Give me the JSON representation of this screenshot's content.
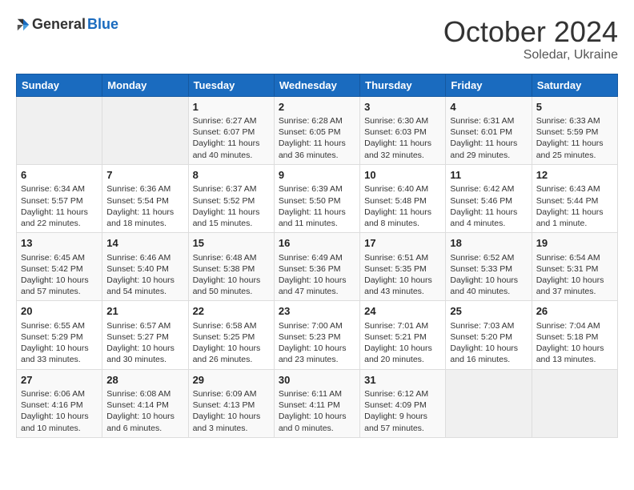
{
  "logo": {
    "general": "General",
    "blue": "Blue"
  },
  "header": {
    "month": "October 2024",
    "location": "Soledar, Ukraine"
  },
  "weekdays": [
    "Sunday",
    "Monday",
    "Tuesday",
    "Wednesday",
    "Thursday",
    "Friday",
    "Saturday"
  ],
  "weeks": [
    [
      {
        "day": "",
        "sunrise": "",
        "sunset": "",
        "daylight": ""
      },
      {
        "day": "",
        "sunrise": "",
        "sunset": "",
        "daylight": ""
      },
      {
        "day": "1",
        "sunrise": "Sunrise: 6:27 AM",
        "sunset": "Sunset: 6:07 PM",
        "daylight": "Daylight: 11 hours and 40 minutes."
      },
      {
        "day": "2",
        "sunrise": "Sunrise: 6:28 AM",
        "sunset": "Sunset: 6:05 PM",
        "daylight": "Daylight: 11 hours and 36 minutes."
      },
      {
        "day": "3",
        "sunrise": "Sunrise: 6:30 AM",
        "sunset": "Sunset: 6:03 PM",
        "daylight": "Daylight: 11 hours and 32 minutes."
      },
      {
        "day": "4",
        "sunrise": "Sunrise: 6:31 AM",
        "sunset": "Sunset: 6:01 PM",
        "daylight": "Daylight: 11 hours and 29 minutes."
      },
      {
        "day": "5",
        "sunrise": "Sunrise: 6:33 AM",
        "sunset": "Sunset: 5:59 PM",
        "daylight": "Daylight: 11 hours and 25 minutes."
      }
    ],
    [
      {
        "day": "6",
        "sunrise": "Sunrise: 6:34 AM",
        "sunset": "Sunset: 5:57 PM",
        "daylight": "Daylight: 11 hours and 22 minutes."
      },
      {
        "day": "7",
        "sunrise": "Sunrise: 6:36 AM",
        "sunset": "Sunset: 5:54 PM",
        "daylight": "Daylight: 11 hours and 18 minutes."
      },
      {
        "day": "8",
        "sunrise": "Sunrise: 6:37 AM",
        "sunset": "Sunset: 5:52 PM",
        "daylight": "Daylight: 11 hours and 15 minutes."
      },
      {
        "day": "9",
        "sunrise": "Sunrise: 6:39 AM",
        "sunset": "Sunset: 5:50 PM",
        "daylight": "Daylight: 11 hours and 11 minutes."
      },
      {
        "day": "10",
        "sunrise": "Sunrise: 6:40 AM",
        "sunset": "Sunset: 5:48 PM",
        "daylight": "Daylight: 11 hours and 8 minutes."
      },
      {
        "day": "11",
        "sunrise": "Sunrise: 6:42 AM",
        "sunset": "Sunset: 5:46 PM",
        "daylight": "Daylight: 11 hours and 4 minutes."
      },
      {
        "day": "12",
        "sunrise": "Sunrise: 6:43 AM",
        "sunset": "Sunset: 5:44 PM",
        "daylight": "Daylight: 11 hours and 1 minute."
      }
    ],
    [
      {
        "day": "13",
        "sunrise": "Sunrise: 6:45 AM",
        "sunset": "Sunset: 5:42 PM",
        "daylight": "Daylight: 10 hours and 57 minutes."
      },
      {
        "day": "14",
        "sunrise": "Sunrise: 6:46 AM",
        "sunset": "Sunset: 5:40 PM",
        "daylight": "Daylight: 10 hours and 54 minutes."
      },
      {
        "day": "15",
        "sunrise": "Sunrise: 6:48 AM",
        "sunset": "Sunset: 5:38 PM",
        "daylight": "Daylight: 10 hours and 50 minutes."
      },
      {
        "day": "16",
        "sunrise": "Sunrise: 6:49 AM",
        "sunset": "Sunset: 5:36 PM",
        "daylight": "Daylight: 10 hours and 47 minutes."
      },
      {
        "day": "17",
        "sunrise": "Sunrise: 6:51 AM",
        "sunset": "Sunset: 5:35 PM",
        "daylight": "Daylight: 10 hours and 43 minutes."
      },
      {
        "day": "18",
        "sunrise": "Sunrise: 6:52 AM",
        "sunset": "Sunset: 5:33 PM",
        "daylight": "Daylight: 10 hours and 40 minutes."
      },
      {
        "day": "19",
        "sunrise": "Sunrise: 6:54 AM",
        "sunset": "Sunset: 5:31 PM",
        "daylight": "Daylight: 10 hours and 37 minutes."
      }
    ],
    [
      {
        "day": "20",
        "sunrise": "Sunrise: 6:55 AM",
        "sunset": "Sunset: 5:29 PM",
        "daylight": "Daylight: 10 hours and 33 minutes."
      },
      {
        "day": "21",
        "sunrise": "Sunrise: 6:57 AM",
        "sunset": "Sunset: 5:27 PM",
        "daylight": "Daylight: 10 hours and 30 minutes."
      },
      {
        "day": "22",
        "sunrise": "Sunrise: 6:58 AM",
        "sunset": "Sunset: 5:25 PM",
        "daylight": "Daylight: 10 hours and 26 minutes."
      },
      {
        "day": "23",
        "sunrise": "Sunrise: 7:00 AM",
        "sunset": "Sunset: 5:23 PM",
        "daylight": "Daylight: 10 hours and 23 minutes."
      },
      {
        "day": "24",
        "sunrise": "Sunrise: 7:01 AM",
        "sunset": "Sunset: 5:21 PM",
        "daylight": "Daylight: 10 hours and 20 minutes."
      },
      {
        "day": "25",
        "sunrise": "Sunrise: 7:03 AM",
        "sunset": "Sunset: 5:20 PM",
        "daylight": "Daylight: 10 hours and 16 minutes."
      },
      {
        "day": "26",
        "sunrise": "Sunrise: 7:04 AM",
        "sunset": "Sunset: 5:18 PM",
        "daylight": "Daylight: 10 hours and 13 minutes."
      }
    ],
    [
      {
        "day": "27",
        "sunrise": "Sunrise: 6:06 AM",
        "sunset": "Sunset: 4:16 PM",
        "daylight": "Daylight: 10 hours and 10 minutes."
      },
      {
        "day": "28",
        "sunrise": "Sunrise: 6:08 AM",
        "sunset": "Sunset: 4:14 PM",
        "daylight": "Daylight: 10 hours and 6 minutes."
      },
      {
        "day": "29",
        "sunrise": "Sunrise: 6:09 AM",
        "sunset": "Sunset: 4:13 PM",
        "daylight": "Daylight: 10 hours and 3 minutes."
      },
      {
        "day": "30",
        "sunrise": "Sunrise: 6:11 AM",
        "sunset": "Sunset: 4:11 PM",
        "daylight": "Daylight: 10 hours and 0 minutes."
      },
      {
        "day": "31",
        "sunrise": "Sunrise: 6:12 AM",
        "sunset": "Sunset: 4:09 PM",
        "daylight": "Daylight: 9 hours and 57 minutes."
      },
      {
        "day": "",
        "sunrise": "",
        "sunset": "",
        "daylight": ""
      },
      {
        "day": "",
        "sunrise": "",
        "sunset": "",
        "daylight": ""
      }
    ]
  ]
}
